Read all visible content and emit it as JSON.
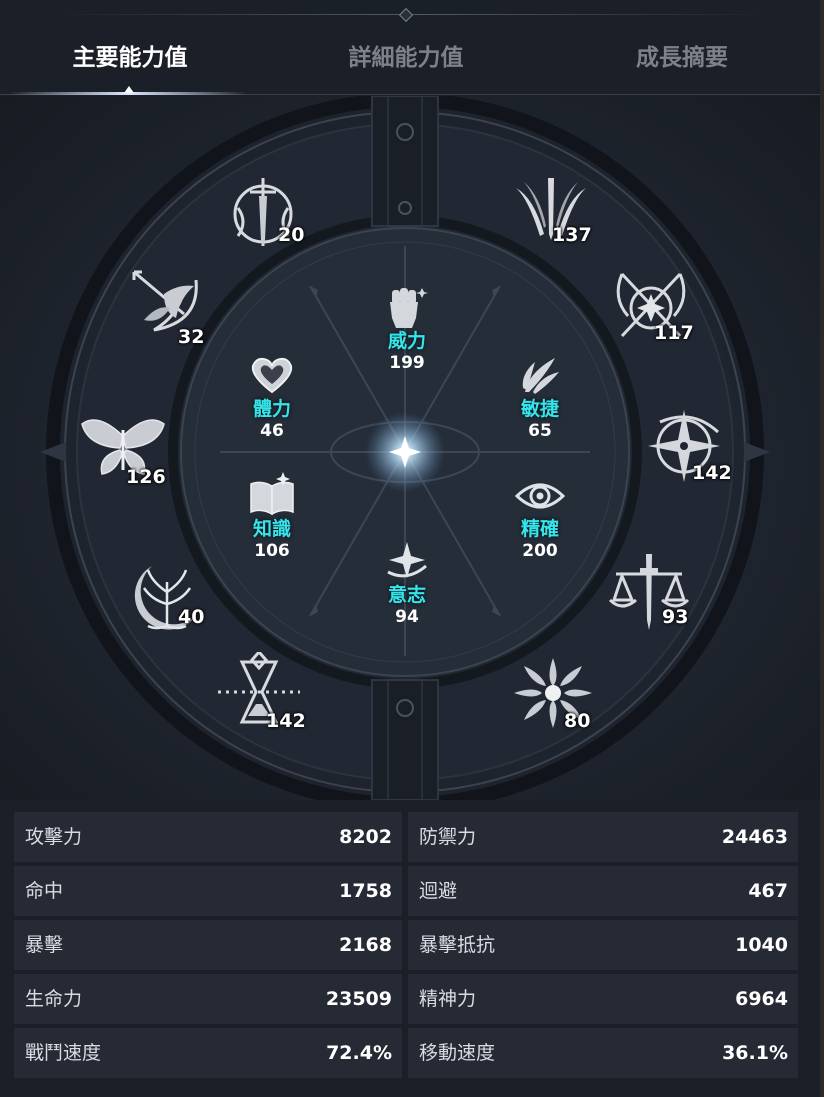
{
  "tabs": [
    {
      "label": "主要能力值",
      "active": true
    },
    {
      "label": "詳細能力值",
      "active": false
    },
    {
      "label": "成長摘要",
      "active": false
    }
  ],
  "outer_stats": [
    {
      "icon": "sword-crest-icon",
      "value": "20"
    },
    {
      "icon": "winged-blades-icon",
      "value": "137"
    },
    {
      "icon": "bird-arrow-icon",
      "value": "32"
    },
    {
      "icon": "crossed-scythes-icon",
      "value": "117"
    },
    {
      "icon": "butterfly-icon",
      "value": "126"
    },
    {
      "icon": "star-compass-icon",
      "value": "142"
    },
    {
      "icon": "tree-moon-icon",
      "value": "40"
    },
    {
      "icon": "scales-dagger-icon",
      "value": "93"
    },
    {
      "icon": "hourglass-icon",
      "value": "142"
    },
    {
      "icon": "radiant-sun-icon",
      "value": "80"
    }
  ],
  "inner_stats": [
    {
      "icon": "fist-icon",
      "name": "威力",
      "value": "199"
    },
    {
      "icon": "heart-icon",
      "name": "體力",
      "value": "46"
    },
    {
      "icon": "wind-feather-icon",
      "name": "敏捷",
      "value": "65"
    },
    {
      "icon": "open-book-icon",
      "name": "知識",
      "value": "106"
    },
    {
      "icon": "eye-icon",
      "name": "精確",
      "value": "200"
    },
    {
      "icon": "spark-orbit-icon",
      "name": "意志",
      "value": "94"
    }
  ],
  "combat_stats": [
    {
      "label": "攻擊力",
      "value": "8202"
    },
    {
      "label": "防禦力",
      "value": "24463"
    },
    {
      "label": "命中",
      "value": "1758"
    },
    {
      "label": "迴避",
      "value": "467"
    },
    {
      "label": "暴擊",
      "value": "2168"
    },
    {
      "label": "暴擊抵抗",
      "value": "1040"
    },
    {
      "label": "生命力",
      "value": "23509"
    },
    {
      "label": "精神力",
      "value": "6964"
    },
    {
      "label": "戰鬥速度",
      "value": "72.4%"
    },
    {
      "label": "移動速度",
      "value": "36.1%"
    }
  ],
  "colors": {
    "accent_cyan": "#34e6ec",
    "panel_bg": "#1b1f27",
    "row_bg": "#262a34",
    "tab_inactive": "#7c818b"
  }
}
